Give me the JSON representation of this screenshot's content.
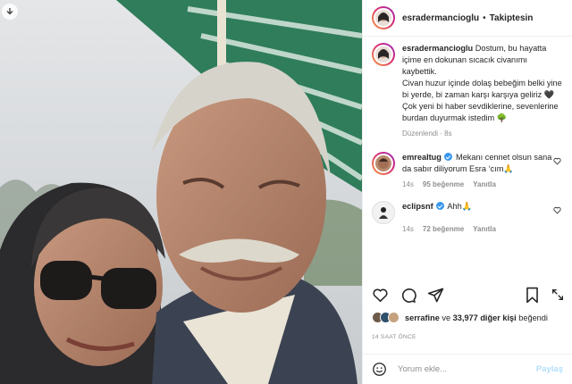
{
  "post": {
    "username": "esradermancioglu",
    "separator": "•",
    "follow_label": "Takiptesin",
    "download_icon": "download-icon"
  },
  "caption": {
    "username": "esradermancioglu",
    "lines": [
      "Dostum, bu hayatta içime en dokunan sıcacık civanımı kaybettik.",
      "Civan huzur içinde dolaş bebeğim belki yine bi yerde, bi zaman karşı karşıya geliriz 🖤",
      "Çok yeni bi haber sevdiklerine, sevenlerine burdan duyurmak istedim 🌳"
    ],
    "edited_label": "Düzenlendi",
    "time": "8s"
  },
  "comments": [
    {
      "username": "emrealtug",
      "verified": true,
      "text": "Mekanı cennet olsun sana da sabır diliyorum Esra ‘cım🙏",
      "time": "14s",
      "likes": "95 beğenme",
      "reply_label": "Yanıtla"
    },
    {
      "username": "eclipsnf",
      "verified": true,
      "text": "Ahh🙏",
      "time": "14s",
      "likes": "72 beğenme",
      "reply_label": "Yanıtla"
    }
  ],
  "likes": {
    "liker": "serrafine",
    "conjunction": "ve",
    "others": "33,977 diğer kişi",
    "suffix": "beğendi"
  },
  "time_ago": "14 SAAT ÖNCE",
  "add_comment": {
    "placeholder": "Yorum ekle...",
    "post_label": "Paylaş"
  },
  "colors": {
    "verified": "#3897f0",
    "post_disabled": "#b2dffc",
    "muted": "#8e8e8e"
  }
}
